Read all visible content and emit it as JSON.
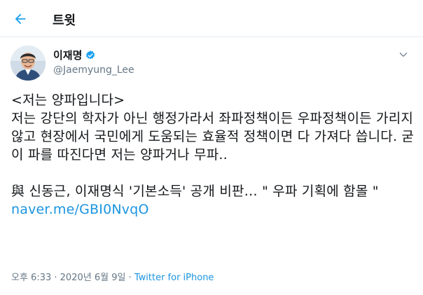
{
  "header": {
    "title": "트윗",
    "back_icon": "arrow-left-icon",
    "accent": "#1da1f2"
  },
  "author": {
    "name": "이재명",
    "handle": "@Jaemyung_Lee",
    "verified_icon": "verified-badge-icon"
  },
  "tweet": {
    "text_before_link": "<저는 양파입니다>\n저는 강단의 학자가 아닌 행정가라서 좌파정책이든 우파정책이든 가리지않고 현장에서 국민에게 도움되는 효율적 정책이면 다 가져다 씁니다. 굳이 파를 따진다면 저는 양파거나 무파..\n\n與 신동근, 이재명식 '기본소득' 공개 비판… \" 우파 기획에 함몰 \" ",
    "link_text": "naver.me/GBI0NvqO",
    "link_color": "#1b95e0"
  },
  "meta": {
    "time": "오후 6:33",
    "separator": " · ",
    "date": "2020년 6월 9일",
    "source": "Twitter for iPhone"
  }
}
